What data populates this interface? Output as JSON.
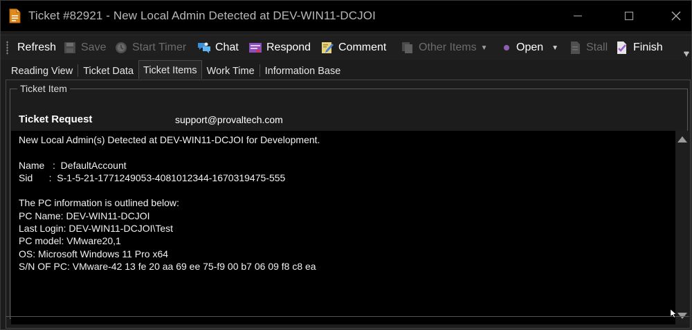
{
  "window": {
    "title": "Ticket #82921 - New Local Admin Detected at DEV-WIN11-DCJOI",
    "icon": "ticket-document-icon",
    "controls": {
      "minimize": "minimize-icon",
      "maximize": "maximize-icon",
      "close": "close-icon"
    }
  },
  "toolbar": {
    "refresh": "Refresh",
    "save": "Save",
    "start_timer": "Start Timer",
    "chat": "Chat",
    "respond": "Respond",
    "comment": "Comment",
    "other_items": "Other Items",
    "status": "Open",
    "stall": "Stall",
    "finish": "Finish"
  },
  "tabs": [
    {
      "label": "Reading View"
    },
    {
      "label": "Ticket Data"
    },
    {
      "label": "Ticket Items"
    },
    {
      "label": "Work Time"
    },
    {
      "label": "Information Base"
    }
  ],
  "active_tab": "Ticket Items",
  "ticket_item": {
    "group_title": "Ticket Item",
    "request_label": "Ticket Request",
    "from_email": "support@provaltech.com",
    "body": "New Local Admin(s) Detected at DEV-WIN11-DCJOI for Development.\n\nName   :  DefaultAccount\nSid      :  S-1-5-21-1771249053-4081012344-1670319475-555\n\nThe PC information is outlined below:\nPC Name: DEV-WIN11-DCJOI\nLast Login: DEV-WIN11-DCJOI\\Test\nPC model: VMware20,1\nOS: Microsoft Windows 11 Pro x64\nS/N OF PC: VMware-42 13 fe 20 aa 69 ee 75-f9 00 b7 06 09 f8 c8 ea"
  },
  "colors": {
    "background": "#1c1c1c",
    "titlebar": "#000000",
    "text_area": "#000000",
    "status_dot": "#8e5fb0",
    "disabled_text": "#6c6c6c"
  }
}
